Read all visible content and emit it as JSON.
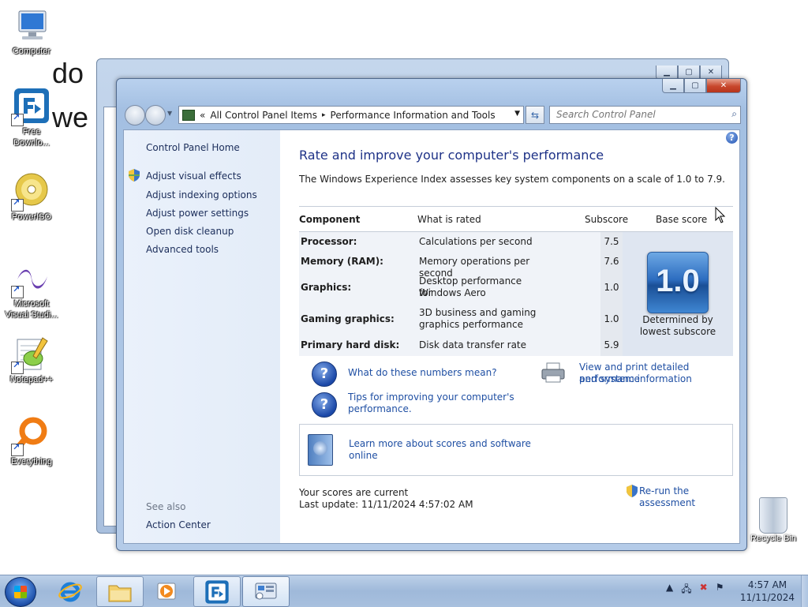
{
  "desktop": {
    "icons": [
      {
        "label_line1": "Computer",
        "label_line2": ""
      },
      {
        "label_line1": "Free",
        "label_line2": "Downlo..."
      },
      {
        "label_line1": "PowerISO",
        "label_line2": ""
      },
      {
        "label_line1": "Microsoft",
        "label_line2": "Visual Studi..."
      },
      {
        "label_line1": "Notepad++",
        "label_line2": ""
      },
      {
        "label_line1": "Everything",
        "label_line2": ""
      }
    ],
    "recycle_bin": "Recycle Bin"
  },
  "back_window": {
    "doc_text_1": "do",
    "doc_text_2": "we"
  },
  "window": {
    "breadcrumb": {
      "prefix": "«",
      "root": "All Control Panel Items",
      "separator": "▸",
      "current": "Performance Information and Tools"
    },
    "search_placeholder": "Search Control Panel",
    "left_pane": {
      "home": "Control Panel Home",
      "links": [
        "Adjust visual effects",
        "Adjust indexing options",
        "Adjust power settings",
        "Open disk cleanup",
        "Advanced tools"
      ],
      "see_also_heading": "See also",
      "see_also": [
        "Action Center"
      ]
    },
    "main": {
      "title": "Rate and improve your computer's performance",
      "description": "The Windows Experience Index assesses key system components on a scale of 1.0 to 7.9.",
      "table": {
        "headers": {
          "component": "Component",
          "rated": "What is rated",
          "subscore": "Subscore",
          "base": "Base score"
        },
        "rows": [
          {
            "component": "Processor:",
            "rated_1": "Calculations per second",
            "rated_2": "",
            "subscore": "7.5"
          },
          {
            "component": "Memory (RAM):",
            "rated_1": "Memory operations per second",
            "rated_2": "",
            "subscore": "7.6"
          },
          {
            "component": "Graphics:",
            "rated_1": "Desktop performance for",
            "rated_2": "Windows Aero",
            "subscore": "1.0"
          },
          {
            "component": "Gaming graphics:",
            "rated_1": "3D business and gaming",
            "rated_2": "graphics performance",
            "subscore": "1.0"
          },
          {
            "component": "Primary hard disk:",
            "rated_1": "Disk data transfer rate",
            "rated_2": "",
            "subscore": "5.9"
          }
        ],
        "base_score": "1.0",
        "determined_1": "Determined by",
        "determined_2": "lowest subscore"
      },
      "links": {
        "numbers": "What do these numbers mean?",
        "tips_1": "Tips for improving your computer's",
        "tips_2": "performance.",
        "print_1": "View and print detailed performance",
        "print_2": "and system information",
        "learn_1": "Learn more about scores and software",
        "learn_2": "online",
        "rerun": "Re-run the assessment"
      },
      "status_1": "Your scores are current",
      "status_2": "Last update: 11/11/2024 4:57:02 AM"
    }
  },
  "taskbar": {
    "time": "4:57 AM",
    "date": "11/11/2024",
    "tray_icons": [
      "chevron-up-icon",
      "network-icon",
      "volume-muted-icon",
      "flag-icon"
    ]
  },
  "colors": {
    "link": "#1f4fa3",
    "title": "#1e3287",
    "left_pane_bg": "#e6eef9"
  }
}
